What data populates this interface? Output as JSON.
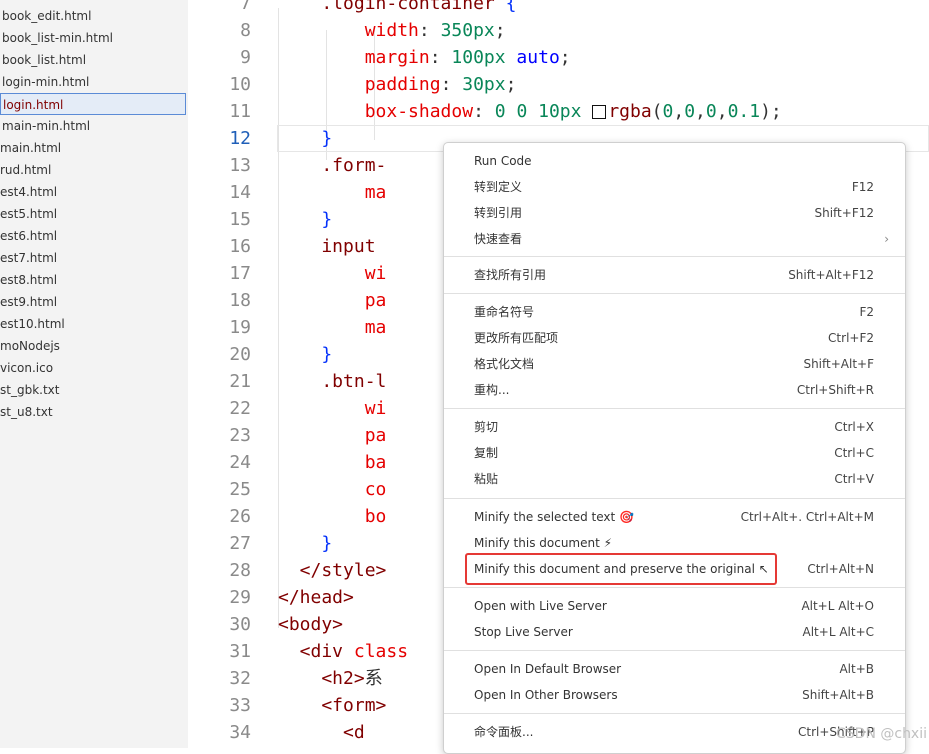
{
  "sidebar": {
    "files": [
      "book_edit.html",
      "book_list-min.html",
      "book_list.html",
      "login-min.html",
      "login.html",
      "main-min.html",
      "main.html",
      "rud.html",
      "est4.html",
      "est5.html",
      "est6.html",
      "est7.html",
      "est8.html",
      "est9.html",
      "est10.html",
      "moNodejs",
      "vicon.ico",
      "st_gbk.txt",
      "st_u8.txt"
    ],
    "selected_file": "login.html"
  },
  "editor": {
    "line_numbers": [
      "7",
      "8",
      "9",
      "10",
      "11",
      "12",
      "13",
      "14",
      "15",
      "16",
      "17",
      "18",
      "19",
      "20",
      "21",
      "22",
      "23",
      "24",
      "25",
      "26",
      "27",
      "28",
      "29",
      "30",
      "31",
      "32",
      "33",
      "34"
    ],
    "active_line": "12",
    "lines": [
      {
        "segments": [
          {
            "t": "    .login-container ",
            "c": "sel"
          },
          {
            "t": "{",
            "c": "br"
          }
        ]
      },
      {
        "segments": [
          {
            "t": "        width",
            "c": "prop"
          },
          {
            "t": ": ",
            "c": "punc"
          },
          {
            "t": "350px",
            "c": "num"
          },
          {
            "t": ";",
            "c": "punc"
          }
        ]
      },
      {
        "segments": [
          {
            "t": "        margin",
            "c": "prop"
          },
          {
            "t": ": ",
            "c": "punc"
          },
          {
            "t": "100px",
            "c": "num"
          },
          {
            "t": " auto",
            "c": "kw"
          },
          {
            "t": ";",
            "c": "punc"
          }
        ]
      },
      {
        "segments": [
          {
            "t": "        padding",
            "c": "prop"
          },
          {
            "t": ": ",
            "c": "punc"
          },
          {
            "t": "30px",
            "c": "num"
          },
          {
            "t": ";",
            "c": "punc"
          }
        ]
      },
      {
        "segments": [
          {
            "t": "        box-shadow",
            "c": "prop"
          },
          {
            "t": ": ",
            "c": "punc"
          },
          {
            "t": "0 0 10px ",
            "c": "num"
          },
          {
            "swatch": true
          },
          {
            "t": "rgba",
            "c": "sel"
          },
          {
            "t": "(",
            "c": "punc"
          },
          {
            "t": "0",
            "c": "num"
          },
          {
            "t": ",",
            "c": "punc"
          },
          {
            "t": "0",
            "c": "num"
          },
          {
            "t": ",",
            "c": "punc"
          },
          {
            "t": "0",
            "c": "num"
          },
          {
            "t": ",",
            "c": "punc"
          },
          {
            "t": "0.1",
            "c": "num"
          },
          {
            "t": ");",
            "c": "punc"
          }
        ]
      },
      {
        "segments": [
          {
            "t": "    }",
            "c": "br"
          }
        ]
      },
      {
        "segments": [
          {
            "t": "    .form-",
            "c": "sel"
          }
        ]
      },
      {
        "segments": [
          {
            "t": "        ma",
            "c": "prop"
          }
        ]
      },
      {
        "segments": [
          {
            "t": "    }",
            "c": "br"
          }
        ]
      },
      {
        "segments": [
          {
            "t": "    input ",
            "c": "sel"
          }
        ]
      },
      {
        "segments": [
          {
            "t": "        wi",
            "c": "prop"
          }
        ]
      },
      {
        "segments": [
          {
            "t": "        pa",
            "c": "prop"
          }
        ]
      },
      {
        "segments": [
          {
            "t": "        ma",
            "c": "prop"
          }
        ]
      },
      {
        "segments": [
          {
            "t": "    }",
            "c": "br"
          }
        ]
      },
      {
        "segments": [
          {
            "t": "    .btn-l",
            "c": "sel"
          }
        ]
      },
      {
        "segments": [
          {
            "t": "        wi",
            "c": "prop"
          }
        ]
      },
      {
        "segments": [
          {
            "t": "        pa",
            "c": "prop"
          }
        ]
      },
      {
        "segments": [
          {
            "t": "        ba",
            "c": "prop"
          }
        ]
      },
      {
        "segments": [
          {
            "t": "        co",
            "c": "prop"
          }
        ]
      },
      {
        "segments": [
          {
            "t": "        bo",
            "c": "prop"
          }
        ]
      },
      {
        "segments": [
          {
            "t": "    }",
            "c": "br"
          }
        ]
      },
      {
        "segments": [
          {
            "t": "  </style>",
            "c": "tag"
          }
        ]
      },
      {
        "segments": [
          {
            "t": "</head>",
            "c": "tag"
          }
        ]
      },
      {
        "segments": [
          {
            "t": "<body>",
            "c": "tag"
          }
        ]
      },
      {
        "segments": [
          {
            "t": "  <div ",
            "c": "tag"
          },
          {
            "t": "class",
            "c": "prop"
          }
        ]
      },
      {
        "segments": [
          {
            "t": "    <h2>",
            "c": "tag"
          },
          {
            "t": "系",
            "c": "punc"
          }
        ]
      },
      {
        "segments": [
          {
            "t": "    <form>",
            "c": "tag"
          }
        ]
      },
      {
        "segments": [
          {
            "t": "      <d",
            "c": "tag"
          }
        ]
      }
    ]
  },
  "context_menu": {
    "groups": [
      [
        {
          "label": "Run Code",
          "shortcut": ""
        },
        {
          "label": "转到定义",
          "shortcut": "F12"
        },
        {
          "label": "转到引用",
          "shortcut": "Shift+F12"
        },
        {
          "label": "快速查看",
          "shortcut": "",
          "submenu": true
        }
      ],
      [
        {
          "label": "查找所有引用",
          "shortcut": "Shift+Alt+F12"
        }
      ],
      [
        {
          "label": "重命名符号",
          "shortcut": "F2"
        },
        {
          "label": "更改所有匹配项",
          "shortcut": "Ctrl+F2"
        },
        {
          "label": "格式化文档",
          "shortcut": "Shift+Alt+F"
        },
        {
          "label": "重构...",
          "shortcut": "Ctrl+Shift+R"
        }
      ],
      [
        {
          "label": "剪切",
          "shortcut": "Ctrl+X"
        },
        {
          "label": "复制",
          "shortcut": "Ctrl+C"
        },
        {
          "label": "粘贴",
          "shortcut": "Ctrl+V"
        }
      ],
      [
        {
          "label": "Minify the selected text 🎯",
          "shortcut": "Ctrl+Alt+. Ctrl+Alt+M"
        },
        {
          "label": "Minify this document ⚡",
          "shortcut": ""
        },
        {
          "label": "Minify this document and preserve the original ↖",
          "shortcut": "Ctrl+Alt+N",
          "highlighted": true
        }
      ],
      [
        {
          "label": "Open with Live Server",
          "shortcut": "Alt+L Alt+O"
        },
        {
          "label": "Stop Live Server",
          "shortcut": "Alt+L Alt+C"
        }
      ],
      [
        {
          "label": "Open In Default Browser",
          "shortcut": "Alt+B"
        },
        {
          "label": "Open In Other Browsers",
          "shortcut": "Shift+Alt+B"
        }
      ],
      [
        {
          "label": "命令面板...",
          "shortcut": "Ctrl+Shift+P"
        }
      ]
    ]
  },
  "watermark": "CSDN @chxii"
}
